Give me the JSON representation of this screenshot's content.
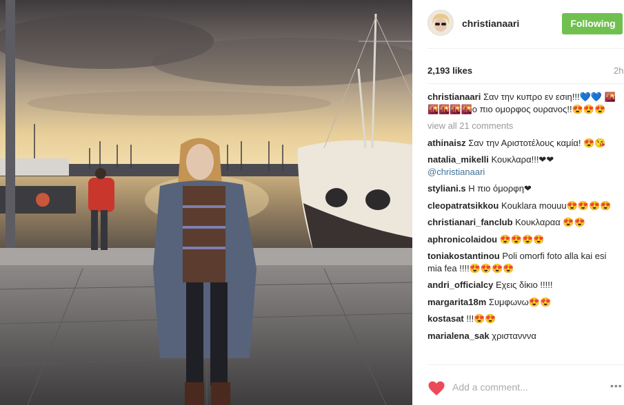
{
  "header": {
    "username": "christianaari",
    "follow_label": "Following"
  },
  "post": {
    "likes": "2,193 likes",
    "time": "2h"
  },
  "caption": {
    "user": "christianaari",
    "text": "Σαν την κυπρο εν εσιη!!!💙💙 🌇🌇🌇🌇🌇ο πιο ομορφος ουρανος!!😍😍😍"
  },
  "view_all": "view all 21 comments",
  "comments": [
    {
      "user": "athinaisz",
      "text": "Σαν την Αριστοτέλους καμία! 😍😘"
    },
    {
      "user": "natalia_mikelli",
      "text": "Κουκλαρα!!!❤❤",
      "mention": "@christianaari"
    },
    {
      "user": "styliani.s",
      "text": "Η πιο όμορφη❤"
    },
    {
      "user": "cleopatratsikkou",
      "text": "Kouklara mouuu😍😍😍😍"
    },
    {
      "user": "christianari_fanclub",
      "text": "Κουκλαραα 😍😍"
    },
    {
      "user": "aphronicolaidou",
      "text": "😍😍😍😍"
    },
    {
      "user": "toniakostantinou",
      "text": "Poli omorfi foto alla kai esi mia fea !!!!😍😍😍😍"
    },
    {
      "user": "andri_officialcy",
      "text": "Εχεις δίκιο !!!!!"
    },
    {
      "user": "margarita18m",
      "text": "Συμφωνω😍😍"
    },
    {
      "user": "kostasat",
      "text": "!!!😍😍"
    },
    {
      "user": "marialena_sak",
      "text": "χριστανννα"
    }
  ],
  "add_comment": {
    "placeholder": "Add a comment...",
    "more": "•••"
  },
  "icons": {
    "like": "heart-icon",
    "options": "more-options-icon"
  },
  "colors": {
    "follow_button": "#70c050",
    "heart": "#ed4956",
    "mention": "#3f729b"
  }
}
